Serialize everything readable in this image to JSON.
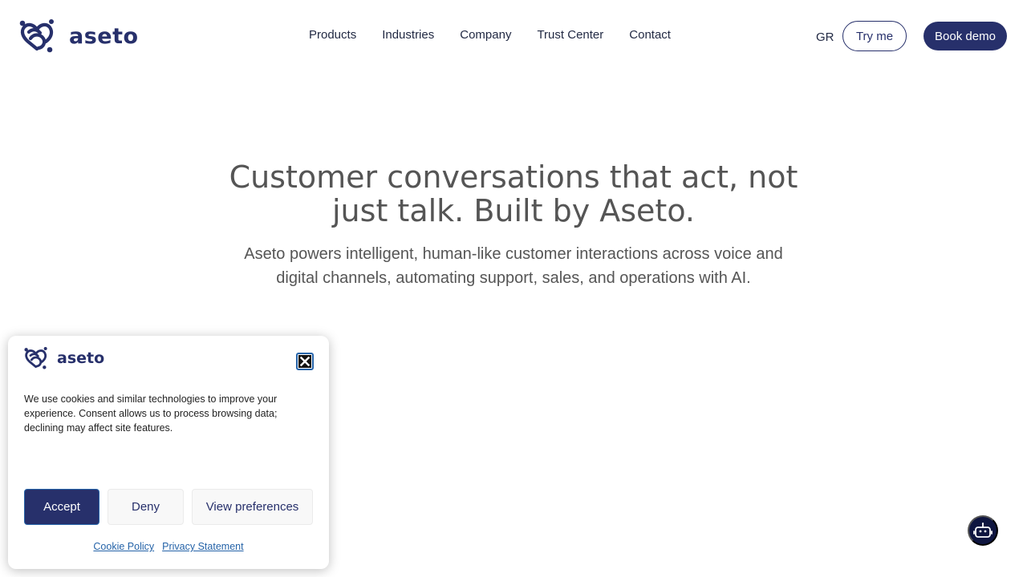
{
  "brand": {
    "name": "aseto",
    "color": "#27306b"
  },
  "nav": {
    "items": [
      {
        "label": "Products"
      },
      {
        "label": "Industries"
      },
      {
        "label": "Company"
      },
      {
        "label": "Trust Center"
      },
      {
        "label": "Contact"
      }
    ],
    "language": "GR",
    "try_label": "Try me",
    "demo_label": "Book demo"
  },
  "hero": {
    "title_line1": "Customer conversations that act, not",
    "title_line2": "just talk. Built by Aseto.",
    "subtitle_line1": "Aseto powers intelligent, human-like customer interactions across voice and",
    "subtitle_line2": "digital channels,  automating support, sales, and operations with AI."
  },
  "cookie": {
    "brand": "aseto",
    "text": "We use cookies and similar technologies to improve your experience. Consent allows us to process browsing data; declining may affect site features.",
    "accept_label": "Accept",
    "deny_label": "Deny",
    "preferences_label": "View preferences",
    "cookie_policy_label": "Cookie Policy",
    "privacy_label": "Privacy Statement",
    "close_icon": "close-icon"
  },
  "chat": {
    "icon": "chatbot-icon"
  }
}
